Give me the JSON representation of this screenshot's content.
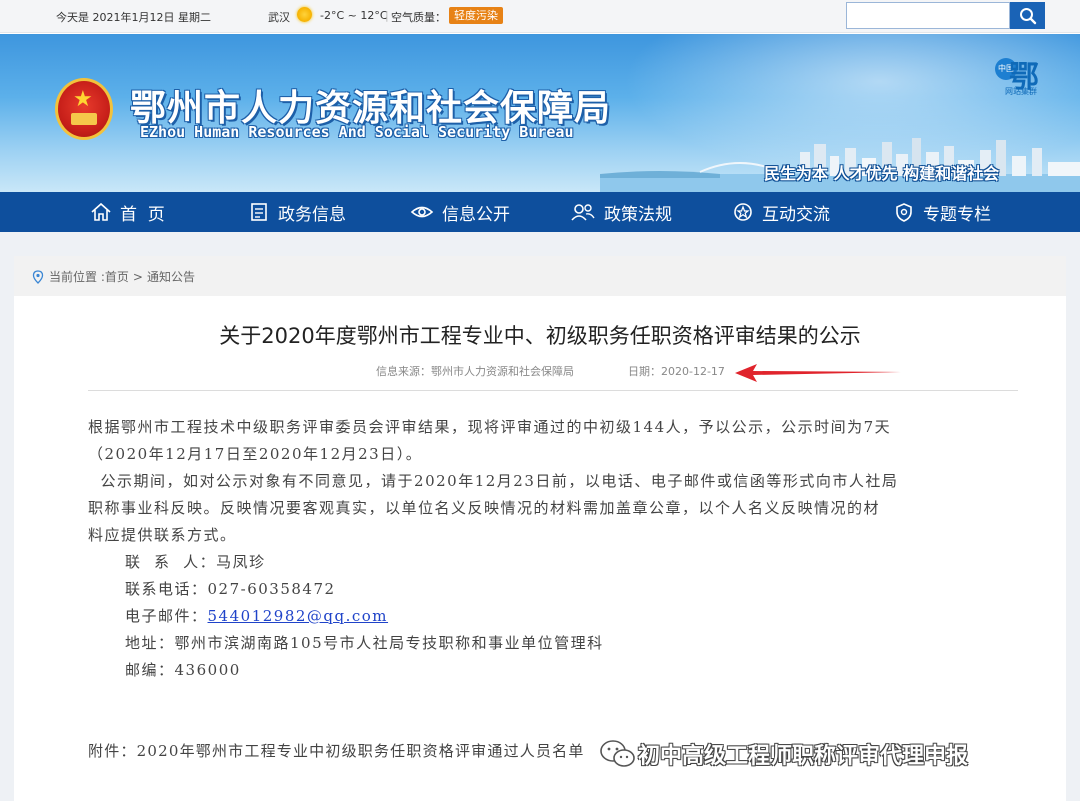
{
  "topbar": {
    "date_text": "今天是 2021年1月12日 星期二",
    "city": "武汉",
    "temperature": "-2°C ~ 12°C",
    "air_quality_label": "空气质量：",
    "air_quality_value": "轻度污染",
    "search_placeholder": ""
  },
  "banner": {
    "title": "鄂州市人力资源和社会保障局",
    "subtitle": "EZhou Human Resources And Social Security Bureau",
    "slogan": "民生为本  人才优先  构建和谐社会",
    "logo_char": "鄂",
    "logo_circle_text": "中国",
    "logo_sub": "网站集群"
  },
  "nav": {
    "items": [
      {
        "label": "首  页",
        "icon": "home-icon"
      },
      {
        "label": "政务信息",
        "icon": "document-icon"
      },
      {
        "label": "信息公开",
        "icon": "eye-icon"
      },
      {
        "label": "政策法规",
        "icon": "people-icon"
      },
      {
        "label": "互动交流",
        "icon": "star-badge-icon"
      },
      {
        "label": "专题专栏",
        "icon": "shield-icon"
      }
    ]
  },
  "breadcrumb": {
    "prefix": "当前位置 :",
    "home": "首页",
    "sep": ">",
    "current": "通知公告"
  },
  "article": {
    "title": "关于2020年度鄂州市工程专业中、初级职务任职资格评审结果的公示",
    "source": "信息来源：鄂州市人力资源和社会保障局",
    "date": "日期：2020-12-17",
    "paragraphs": {
      "p1_line1": "根据鄂州市工程技术中级职务评审委员会评审结果，现将评审通过的中初级144人，予以公示，公示时间为7天",
      "p1_line2": "（2020年12月17日至2020年12月23日）。",
      "p2_line1": "  公示期间，如对公示对象有不同意见，请于2020年12月23日前，以电话、电子邮件或信函等形式向市人社局",
      "p2_line2": "职称事业科反映。反映情况要客观真实，以单位名义反映情况的材料需加盖章公章，以个人名义反映情况的材",
      "p2_line3": "料应提供联系方式。"
    },
    "contact": {
      "person_label": "联  系  人：",
      "person": "马凤珍",
      "phone_label": "联系电话：",
      "phone": "027-60358472",
      "email_label": "电子邮件：",
      "email": "544012982@qq.com",
      "address_label": "地址：",
      "address": "鄂州市滨湖南路105号市人社局专技职称和事业单位管理科",
      "postcode_label": "邮编：",
      "postcode": "436000"
    },
    "attachment": "附件：2020年鄂州市工程专业中初级职务任职资格评审通过人员名单"
  },
  "watermark": {
    "text": "初中高级工程师职称评审代理申报"
  },
  "colors": {
    "nav_bg": "#0e4f9d",
    "banner_top": "#3e96de",
    "air_badge": "#e78216",
    "arrow": "#e0242c",
    "link": "#1f43c9"
  }
}
